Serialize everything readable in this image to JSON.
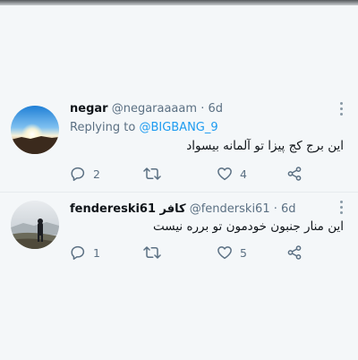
{
  "colors": {
    "background": "#f4f7f9",
    "mention": "#1d9bf0",
    "secondary_text": "#5b7083",
    "primary_text": "#0f1419"
  },
  "tweets": [
    {
      "display_name": "negar",
      "handle": "@negaraaaam",
      "separator": "·",
      "time": "6d",
      "replying_label": "Replying to",
      "replying_to": "@BIGBANG_9",
      "text": "این برج کج پیزا تو آلمانه بیسواد",
      "avatar_icon": "sunset-sky-avatar",
      "actions": {
        "reply": {
          "icon": "reply-icon",
          "count": "2"
        },
        "retweet": {
          "icon": "retweet-icon",
          "count": ""
        },
        "like": {
          "icon": "heart-icon",
          "count": "4"
        },
        "share": {
          "icon": "share-icon",
          "count": ""
        }
      }
    },
    {
      "display_name": "fendereski61 کافر",
      "handle": "@fenderski61",
      "separator": "·",
      "time": "6d",
      "text": "این منار جنبون خودمون تو  برره نیست",
      "avatar_icon": "person-on-hill-avatar",
      "actions": {
        "reply": {
          "icon": "reply-icon",
          "count": "1"
        },
        "retweet": {
          "icon": "retweet-icon",
          "count": ""
        },
        "like": {
          "icon": "heart-icon",
          "count": "5"
        },
        "share": {
          "icon": "share-icon",
          "count": ""
        }
      }
    }
  ]
}
